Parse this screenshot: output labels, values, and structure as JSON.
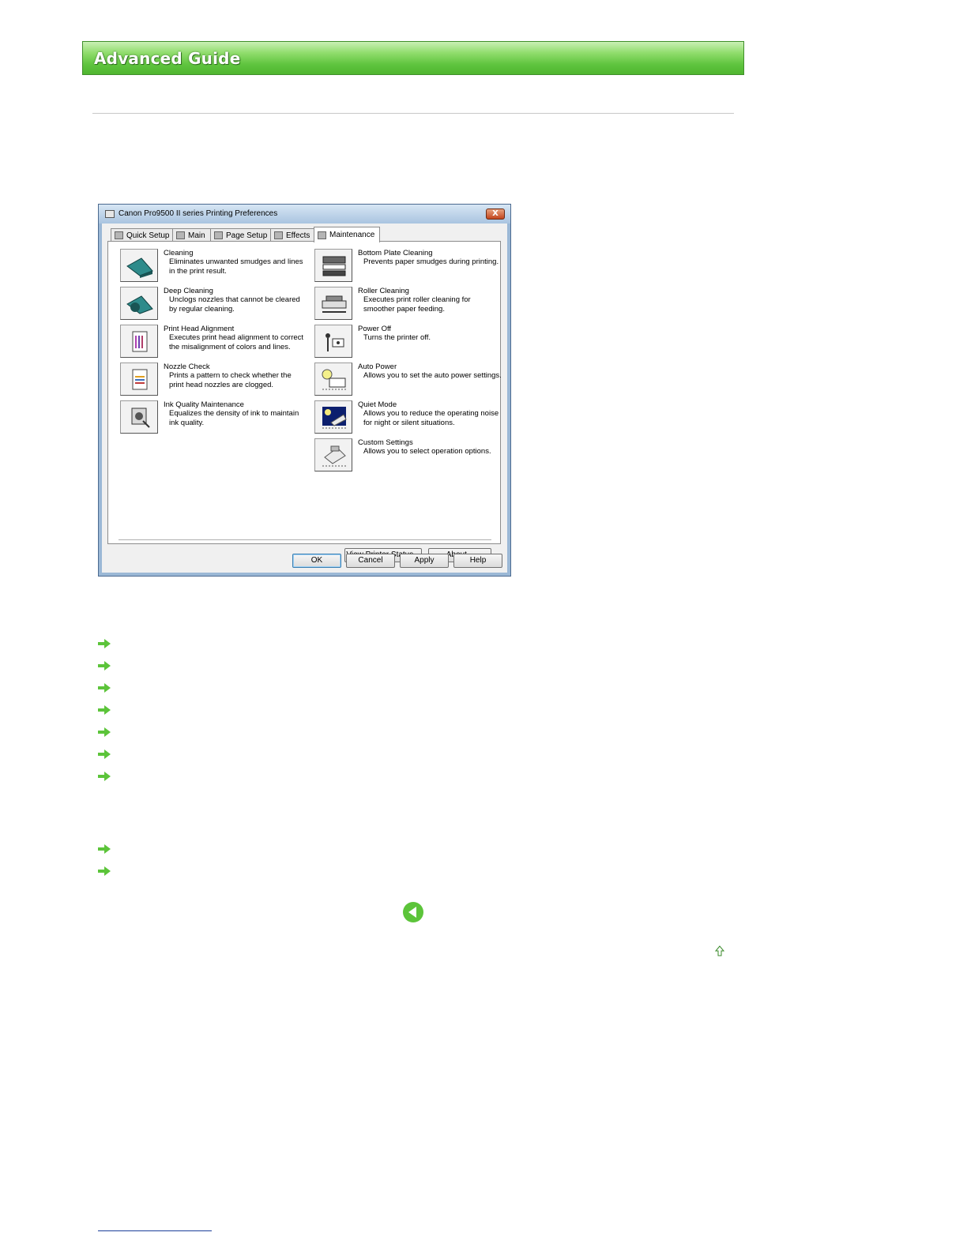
{
  "header": {
    "title": "Advanced Guide"
  },
  "dialog": {
    "title": "Canon Pro9500 II series Printing Preferences",
    "close_label": "X",
    "tabs": [
      {
        "label": "Quick Setup"
      },
      {
        "label": "Main"
      },
      {
        "label": "Page Setup"
      },
      {
        "label": "Effects"
      },
      {
        "label": "Maintenance"
      }
    ],
    "left_functions": [
      {
        "title": "Cleaning",
        "desc": "Eliminates unwanted smudges and lines in the print result.",
        "icon": "cleaning-icon"
      },
      {
        "title": "Deep Cleaning",
        "desc": "Unclogs nozzles that cannot be cleared by regular cleaning.",
        "icon": "deep-cleaning-icon"
      },
      {
        "title": "Print Head Alignment",
        "desc": "Executes print head alignment to correct the misalignment of colors and lines.",
        "icon": "print-head-alignment-icon"
      },
      {
        "title": "Nozzle Check",
        "desc": "Prints a pattern to check whether the print head nozzles are clogged.",
        "icon": "nozzle-check-icon"
      },
      {
        "title": "Ink Quality Maintenance",
        "desc": "Equalizes the density of ink to maintain ink quality.",
        "icon": "ink-quality-icon"
      }
    ],
    "right_functions": [
      {
        "title": "Bottom Plate Cleaning",
        "desc": "Prevents paper smudges during printing.",
        "icon": "bottom-plate-icon"
      },
      {
        "title": "Roller Cleaning",
        "desc": "Executes print roller cleaning for smoother paper feeding.",
        "icon": "roller-cleaning-icon"
      },
      {
        "title": "Power Off",
        "desc": "Turns the printer off.",
        "icon": "power-off-icon"
      },
      {
        "title": "Auto Power",
        "desc": "Allows you to set the auto power settings.",
        "icon": "auto-power-icon"
      },
      {
        "title": "Quiet Mode",
        "desc": "Allows you to reduce the operating noise for night or silent situations.",
        "icon": "quiet-mode-icon"
      },
      {
        "title": "Custom Settings",
        "desc": "Allows you to select operation options.",
        "icon": "custom-settings-icon"
      }
    ],
    "buttons": {
      "view_status": "View Printer Status...",
      "about": "About...",
      "ok": "OK",
      "cancel": "Cancel",
      "apply": "Apply",
      "help": "Help"
    }
  },
  "links": {
    "group1_count": 7,
    "group2_count": 2,
    "arrow_color": "#5cc43a"
  },
  "colors": {
    "banner_green": "#5fc43e",
    "link_blue": "#1a3e9a"
  }
}
